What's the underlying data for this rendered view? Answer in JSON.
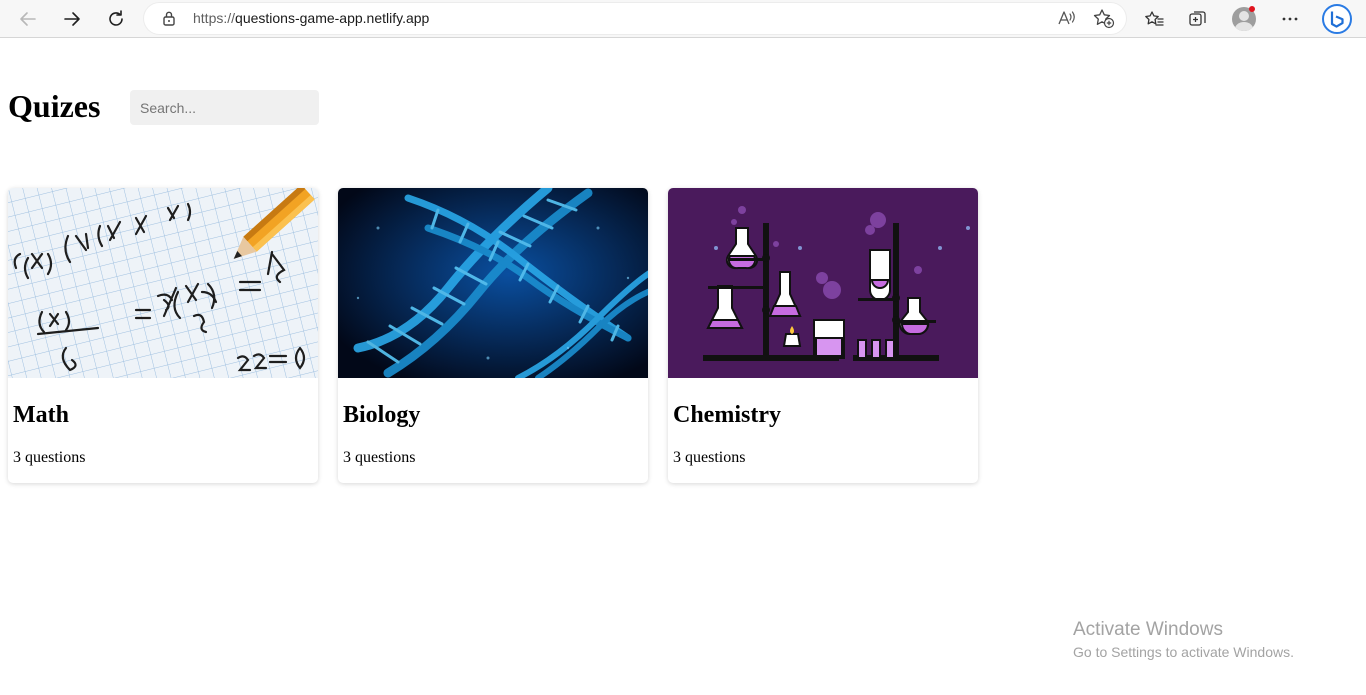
{
  "browser": {
    "url_protocol": "https://",
    "url_host": "questions-game-app.netlify.app",
    "icons": {
      "back": "arrow-left-icon",
      "forward": "arrow-right-icon",
      "refresh": "refresh-icon",
      "lock": "lock-icon",
      "read_aloud": "read-aloud-icon",
      "add_favorite": "star-plus-icon",
      "favorites": "favorites-icon",
      "collections": "collections-icon",
      "profile": "profile-icon",
      "menu": "ellipsis-icon",
      "bing": "bing-icon"
    }
  },
  "page": {
    "title": "Quizes",
    "search_placeholder": "Search..."
  },
  "quizzes": [
    {
      "title": "Math",
      "count": "3 questions",
      "image": "math-notebook-image"
    },
    {
      "title": "Biology",
      "count": "3 questions",
      "image": "dna-helix-image"
    },
    {
      "title": "Chemistry",
      "count": "3 questions",
      "image": "lab-flasks-image"
    }
  ],
  "watermark": {
    "line1": "Activate Windows",
    "line2": "Go to Settings to activate Windows."
  },
  "colors": {
    "chrome_bg": "#f7f7f7",
    "search_bg": "#f0f0f0",
    "chemistry_bg": "#4a1a5c",
    "biology_bg": "#061a3a",
    "dna_blue": "#2aa8e8"
  }
}
